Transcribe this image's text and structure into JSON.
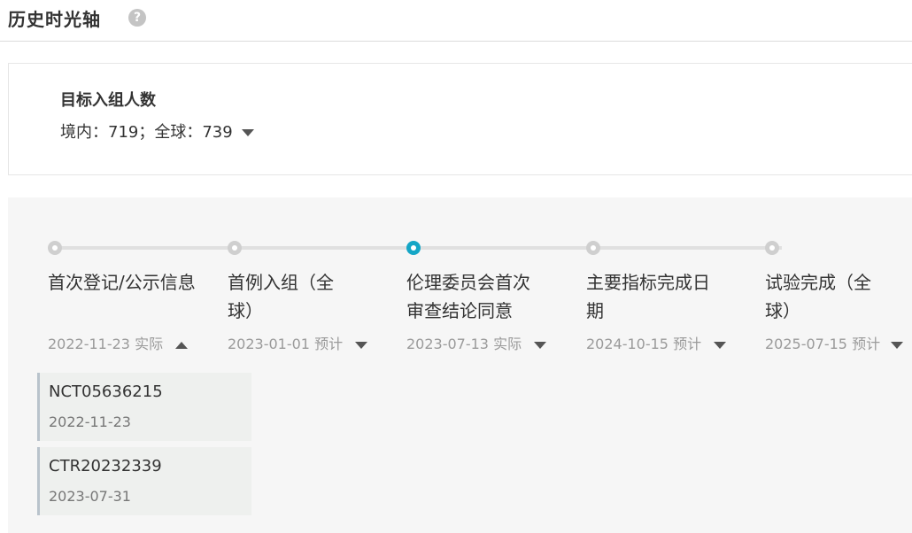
{
  "header": {
    "title": "历史时光轴",
    "help_icon": "?"
  },
  "enrollment": {
    "title": "目标入组人数",
    "values": "境内：719；全球：739"
  },
  "timeline": {
    "milestones": [
      {
        "name": "首次登记/公示信息",
        "date": "2022-11-23",
        "status": "实际",
        "expanded": true,
        "active": false
      },
      {
        "name": "首例入组（全球）",
        "date": "2023-01-01",
        "status": "预计",
        "expanded": false,
        "active": false
      },
      {
        "name": "伦理委员会首次审查结论同意",
        "date": "2023-07-13",
        "status": "实际",
        "expanded": false,
        "active": true
      },
      {
        "name": "主要指标完成日期",
        "date": "2024-10-15",
        "status": "预计",
        "expanded": false,
        "active": false
      },
      {
        "name": "试验完成（全球）",
        "date": "2025-07-15",
        "status": "预计",
        "expanded": false,
        "active": false
      }
    ],
    "registrations": [
      {
        "id": "NCT05636215",
        "date": "2022-11-23"
      },
      {
        "id": "CTR20232339",
        "date": "2023-07-31"
      }
    ]
  },
  "colors": {
    "active_node": "#15a6c6",
    "inactive_node": "#cfcfcf",
    "panel_bg": "#f6f6f6"
  }
}
